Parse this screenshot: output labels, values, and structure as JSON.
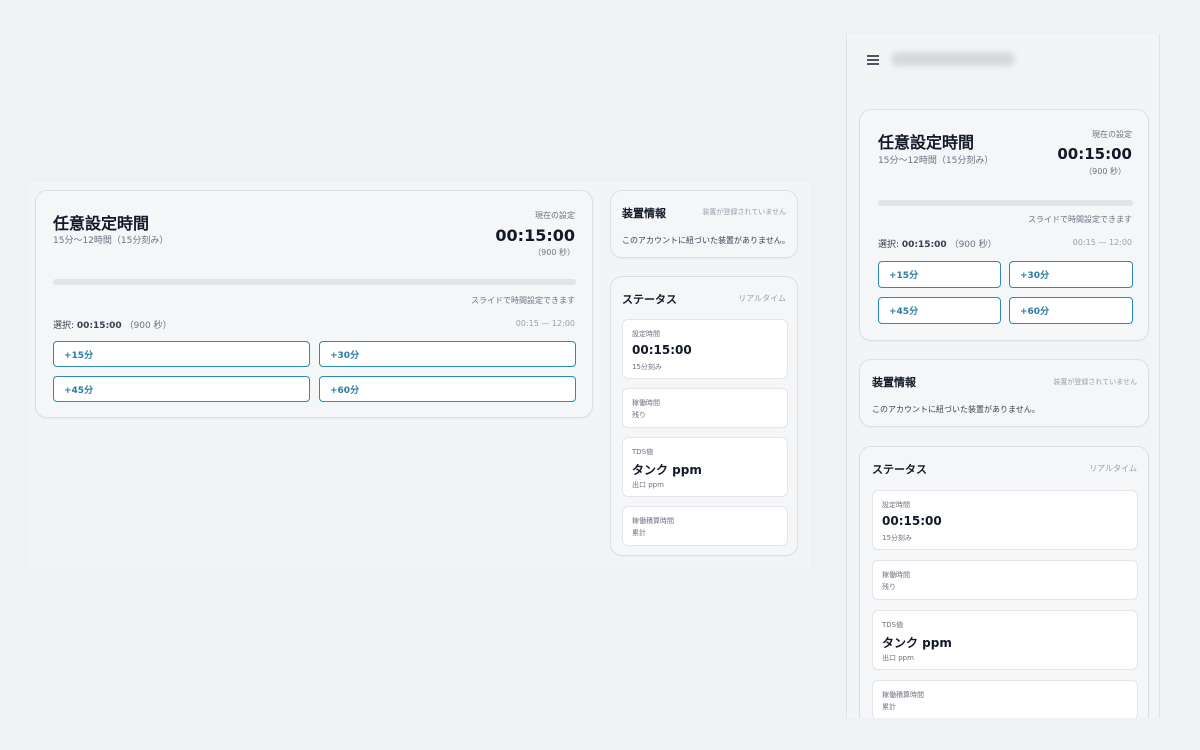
{
  "timer": {
    "title": "任意設定時間",
    "range": "15分〜12時間（15分刻み）",
    "current_label": "現在の設定",
    "current_value": "00:15:00",
    "current_seconds": "（900 秒）",
    "slider_hint": "スライドで時間設定できます",
    "selection_label": "選択:",
    "selection_value": "00:15:00",
    "selection_seconds": "（900 秒）",
    "range_short": "00:15 — 12:00",
    "slider_fraction": 0,
    "buttons": [
      {
        "label": "+15分"
      },
      {
        "label": "+30分"
      },
      {
        "label": "+45分"
      },
      {
        "label": "+60分"
      }
    ]
  },
  "device": {
    "title": "装置情報",
    "status": "装置が登録されていません",
    "message": "このアカウントに紐づいた装置がありません。"
  },
  "status": {
    "title": "ステータス",
    "badge": "リアルタイム",
    "items": [
      {
        "label": "設定時間",
        "value": "00:15:00",
        "sub": "15分刻み"
      },
      {
        "label": "稼働時間",
        "value": "",
        "sub": "残り"
      },
      {
        "label": "TDS値",
        "value": "タンク ppm",
        "sub": "出口 ppm"
      },
      {
        "label": "稼働積算時間",
        "value": "",
        "sub": "累計"
      }
    ]
  },
  "mobile_header": {
    "menu_icon": "hamburger-menu-icon"
  }
}
